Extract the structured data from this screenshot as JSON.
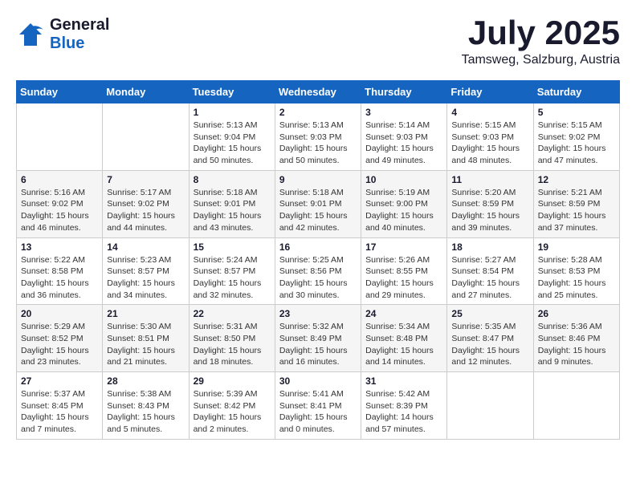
{
  "header": {
    "logo_general": "General",
    "logo_blue": "Blue",
    "title": "July 2025",
    "location": "Tamsweg, Salzburg, Austria"
  },
  "weekdays": [
    "Sunday",
    "Monday",
    "Tuesday",
    "Wednesday",
    "Thursday",
    "Friday",
    "Saturday"
  ],
  "weeks": [
    [
      {
        "day": "",
        "content": ""
      },
      {
        "day": "",
        "content": ""
      },
      {
        "day": "1",
        "content": "Sunrise: 5:13 AM\nSunset: 9:04 PM\nDaylight: 15 hours\nand 50 minutes."
      },
      {
        "day": "2",
        "content": "Sunrise: 5:13 AM\nSunset: 9:03 PM\nDaylight: 15 hours\nand 50 minutes."
      },
      {
        "day": "3",
        "content": "Sunrise: 5:14 AM\nSunset: 9:03 PM\nDaylight: 15 hours\nand 49 minutes."
      },
      {
        "day": "4",
        "content": "Sunrise: 5:15 AM\nSunset: 9:03 PM\nDaylight: 15 hours\nand 48 minutes."
      },
      {
        "day": "5",
        "content": "Sunrise: 5:15 AM\nSunset: 9:02 PM\nDaylight: 15 hours\nand 47 minutes."
      }
    ],
    [
      {
        "day": "6",
        "content": "Sunrise: 5:16 AM\nSunset: 9:02 PM\nDaylight: 15 hours\nand 46 minutes."
      },
      {
        "day": "7",
        "content": "Sunrise: 5:17 AM\nSunset: 9:02 PM\nDaylight: 15 hours\nand 44 minutes."
      },
      {
        "day": "8",
        "content": "Sunrise: 5:18 AM\nSunset: 9:01 PM\nDaylight: 15 hours\nand 43 minutes."
      },
      {
        "day": "9",
        "content": "Sunrise: 5:18 AM\nSunset: 9:01 PM\nDaylight: 15 hours\nand 42 minutes."
      },
      {
        "day": "10",
        "content": "Sunrise: 5:19 AM\nSunset: 9:00 PM\nDaylight: 15 hours\nand 40 minutes."
      },
      {
        "day": "11",
        "content": "Sunrise: 5:20 AM\nSunset: 8:59 PM\nDaylight: 15 hours\nand 39 minutes."
      },
      {
        "day": "12",
        "content": "Sunrise: 5:21 AM\nSunset: 8:59 PM\nDaylight: 15 hours\nand 37 minutes."
      }
    ],
    [
      {
        "day": "13",
        "content": "Sunrise: 5:22 AM\nSunset: 8:58 PM\nDaylight: 15 hours\nand 36 minutes."
      },
      {
        "day": "14",
        "content": "Sunrise: 5:23 AM\nSunset: 8:57 PM\nDaylight: 15 hours\nand 34 minutes."
      },
      {
        "day": "15",
        "content": "Sunrise: 5:24 AM\nSunset: 8:57 PM\nDaylight: 15 hours\nand 32 minutes."
      },
      {
        "day": "16",
        "content": "Sunrise: 5:25 AM\nSunset: 8:56 PM\nDaylight: 15 hours\nand 30 minutes."
      },
      {
        "day": "17",
        "content": "Sunrise: 5:26 AM\nSunset: 8:55 PM\nDaylight: 15 hours\nand 29 minutes."
      },
      {
        "day": "18",
        "content": "Sunrise: 5:27 AM\nSunset: 8:54 PM\nDaylight: 15 hours\nand 27 minutes."
      },
      {
        "day": "19",
        "content": "Sunrise: 5:28 AM\nSunset: 8:53 PM\nDaylight: 15 hours\nand 25 minutes."
      }
    ],
    [
      {
        "day": "20",
        "content": "Sunrise: 5:29 AM\nSunset: 8:52 PM\nDaylight: 15 hours\nand 23 minutes."
      },
      {
        "day": "21",
        "content": "Sunrise: 5:30 AM\nSunset: 8:51 PM\nDaylight: 15 hours\nand 21 minutes."
      },
      {
        "day": "22",
        "content": "Sunrise: 5:31 AM\nSunset: 8:50 PM\nDaylight: 15 hours\nand 18 minutes."
      },
      {
        "day": "23",
        "content": "Sunrise: 5:32 AM\nSunset: 8:49 PM\nDaylight: 15 hours\nand 16 minutes."
      },
      {
        "day": "24",
        "content": "Sunrise: 5:34 AM\nSunset: 8:48 PM\nDaylight: 15 hours\nand 14 minutes."
      },
      {
        "day": "25",
        "content": "Sunrise: 5:35 AM\nSunset: 8:47 PM\nDaylight: 15 hours\nand 12 minutes."
      },
      {
        "day": "26",
        "content": "Sunrise: 5:36 AM\nSunset: 8:46 PM\nDaylight: 15 hours\nand 9 minutes."
      }
    ],
    [
      {
        "day": "27",
        "content": "Sunrise: 5:37 AM\nSunset: 8:45 PM\nDaylight: 15 hours\nand 7 minutes."
      },
      {
        "day": "28",
        "content": "Sunrise: 5:38 AM\nSunset: 8:43 PM\nDaylight: 15 hours\nand 5 minutes."
      },
      {
        "day": "29",
        "content": "Sunrise: 5:39 AM\nSunset: 8:42 PM\nDaylight: 15 hours\nand 2 minutes."
      },
      {
        "day": "30",
        "content": "Sunrise: 5:41 AM\nSunset: 8:41 PM\nDaylight: 15 hours\nand 0 minutes."
      },
      {
        "day": "31",
        "content": "Sunrise: 5:42 AM\nSunset: 8:39 PM\nDaylight: 14 hours\nand 57 minutes."
      },
      {
        "day": "",
        "content": ""
      },
      {
        "day": "",
        "content": ""
      }
    ]
  ]
}
